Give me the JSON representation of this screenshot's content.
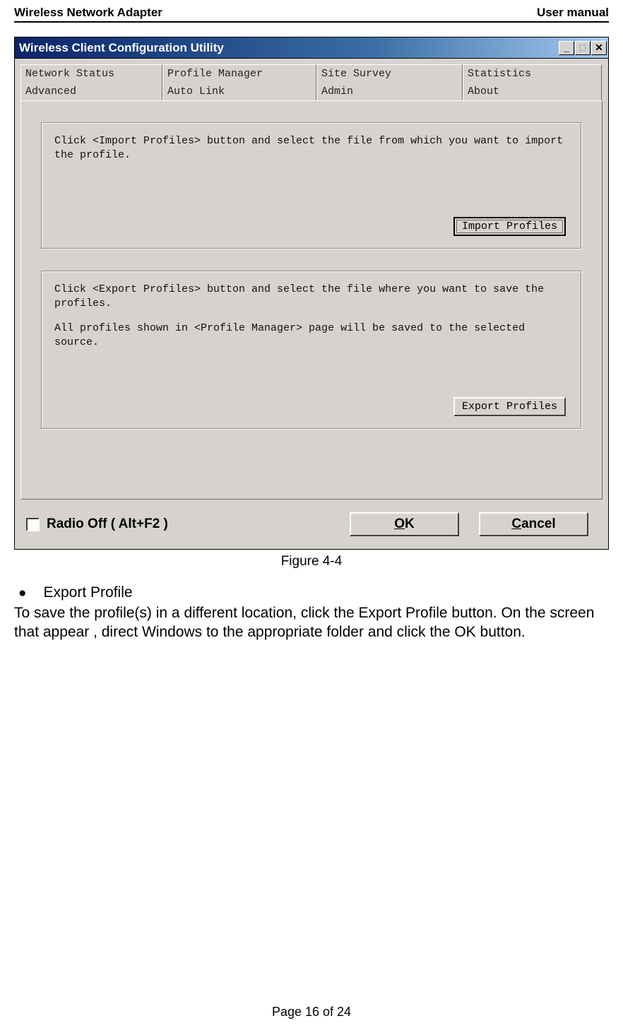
{
  "header": {
    "left": "Wireless Network Adapter",
    "right": "User manual"
  },
  "window": {
    "title": "Wireless Client Configuration Utility",
    "tabs_row1": [
      "Network Status",
      "Profile Manager",
      "Site Survey",
      "Statistics"
    ],
    "tabs_row2": [
      "Advanced",
      "Auto Link",
      "Admin",
      "About"
    ],
    "active_tab": "Admin",
    "import_box": {
      "text": "Click <Import Profiles> button and select the file from which you want to import the profile.",
      "button": "Import Profiles"
    },
    "export_box": {
      "text1": "Click <Export Profiles> button and select the file where you want to save the profiles.",
      "text2": "All profiles shown in <Profile Manager> page will be saved to the selected source.",
      "button": "Export Profiles"
    },
    "radio_label": "Radio Off  ( Alt+F2 )",
    "ok": "OK",
    "cancel": "Cancel"
  },
  "figure_caption": "Figure 4-4",
  "bullet_title": "Export Profile",
  "paragraph": "To save the profile(s) in a different location, click the Export Profile button. On the screen that appear , direct Windows to the appropriate folder and click the OK button.",
  "footer": "Page 16 of 24"
}
